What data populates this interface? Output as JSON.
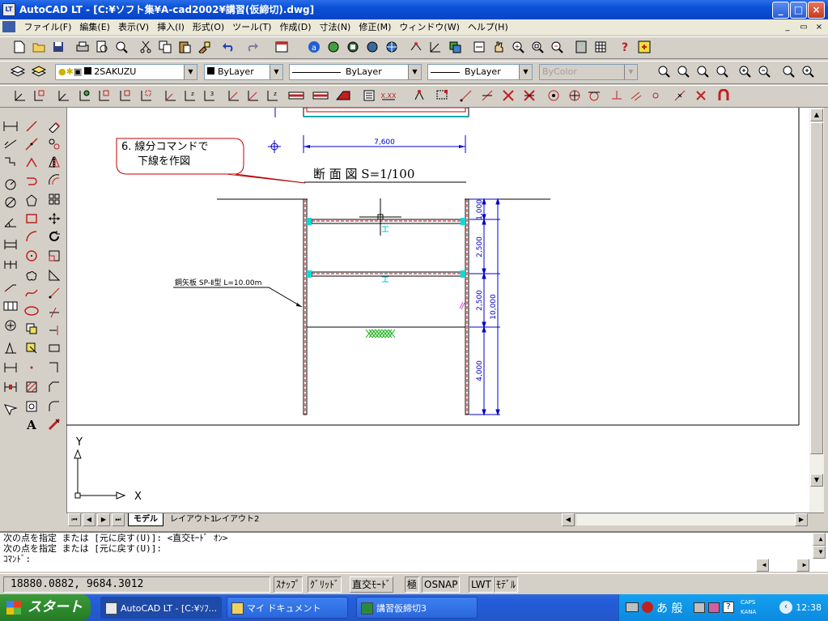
{
  "window": {
    "title": "AutoCAD LT - [C:¥ソフト集¥A-cad2002¥講習(仮締切).dwg]",
    "app_icon_label": "LT",
    "minimize": "_",
    "maximize": "□",
    "close": "×"
  },
  "menu": [
    "ファイル(F)",
    "編集(E)",
    "表示(V)",
    "挿入(I)",
    "形式(O)",
    "ツール(T)",
    "作成(D)",
    "寸法(N)",
    "修正(M)",
    "ウィンドウ(W)",
    "ヘルプ(H)"
  ],
  "mdi_buttons": [
    "_",
    "▭",
    "×"
  ],
  "layer_toolbar": {
    "layer_name": "2SAKUZU",
    "color": "ByLayer",
    "linetype": "ByLayer",
    "lineweight": "ByLayer",
    "plotstyle": "ByColor"
  },
  "drawing": {
    "callout": [
      "6. 線分コマンドで",
      "下線を作図"
    ],
    "title": "断 面 図  S=1/100",
    "dim_top": "7,600",
    "dims_right": [
      "1,000",
      "2,500",
      "2,500",
      "4,000"
    ],
    "dim_total": "10,000",
    "label_sheetpile": "鋼矢板 SP-Ⅱ型 L=10.00m",
    "ucs_x": "X",
    "ucs_y": "Y"
  },
  "tabs": [
    "モデル",
    "レイアウト1",
    "レイアウト2"
  ],
  "command_lines": [
    "次の点を指定 または [元に戻す(U)]: <直交ﾓｰﾄﾞ ｵﾝ>",
    "次の点を指定 または [元に戻す(U)]:",
    "ｺﾏﾝﾄﾞ:"
  ],
  "status": {
    "coords": "18880.0882, 9684.3012",
    "buttons": [
      {
        "label": "ｽﾅｯﾌﾟ",
        "on": false
      },
      {
        "label": "ｸﾞﾘｯﾄﾞ",
        "on": false
      },
      {
        "label": "直交ﾓｰﾄﾞ",
        "on": true
      },
      {
        "label": "極",
        "on": false
      },
      {
        "label": "OSNAP",
        "on": false
      },
      {
        "label": "LWT",
        "on": false
      },
      {
        "label": "ﾓﾃﾞﾙ",
        "on": false
      }
    ]
  },
  "taskbar": {
    "start": "スタート",
    "tasks": [
      {
        "label": "AutoCAD LT - [C:¥ｿﾌ...",
        "active": true
      },
      {
        "label": "マイ ドキュメント",
        "active": false
      },
      {
        "label": "講習仮締切3",
        "active": false
      }
    ],
    "ime": "あ 般",
    "caps": "CAPS",
    "kana": "KANA",
    "clock": "12:38"
  },
  "colors": {
    "titlebar": "#0a50d8",
    "drawing_line": "#000000",
    "dimension": "#0000cc",
    "sheet_pile": "#cc0000",
    "strut_mark": "#00cccc",
    "callout_border": "#cc0000",
    "hatch": "#00aa00"
  }
}
